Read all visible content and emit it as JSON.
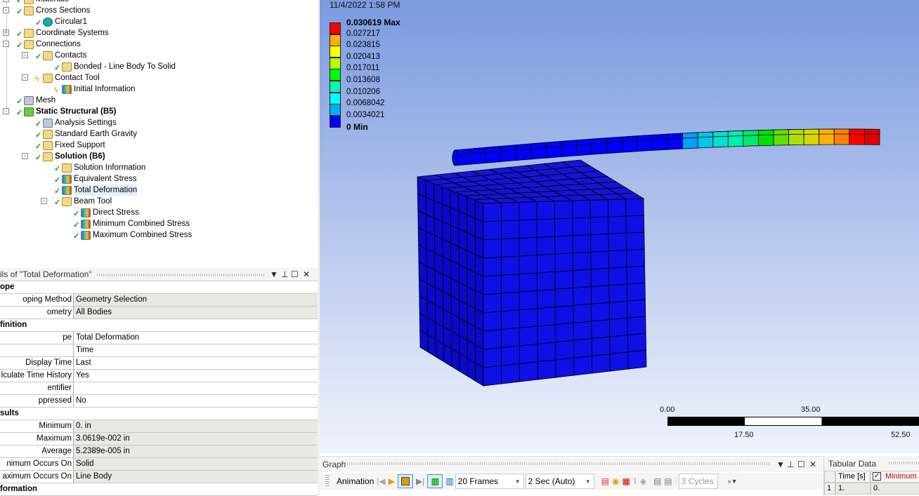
{
  "tree": [
    {
      "label": "Materials",
      "level": 0,
      "icon": "materials-icon",
      "status": "check",
      "exp": "+"
    },
    {
      "label": "Cross Sections",
      "level": 0,
      "icon": "cross-section-icon",
      "status": "check",
      "exp": "-"
    },
    {
      "label": "Circular1",
      "level": 1,
      "icon": "circular-section-icon",
      "status": "check"
    },
    {
      "label": "Coordinate Systems",
      "level": 0,
      "icon": "coordinate-systems-icon",
      "status": "check",
      "exp": "+"
    },
    {
      "label": "Connections",
      "level": 0,
      "icon": "connections-icon",
      "status": "check",
      "exp": "-"
    },
    {
      "label": "Contacts",
      "level": 1,
      "icon": "contacts-folder-icon",
      "status": "check",
      "exp": "-"
    },
    {
      "label": "Bonded - Line Body To Solid",
      "level": 2,
      "icon": "bonded-contact-icon",
      "status": "check"
    },
    {
      "label": "Contact Tool",
      "level": 1,
      "icon": "contact-tool-icon",
      "status": "bolt",
      "exp": "-"
    },
    {
      "label": "Initial Information",
      "level": 2,
      "icon": "result-icon",
      "status": "bolt"
    },
    {
      "label": "Mesh",
      "level": 0,
      "icon": "mesh-icon",
      "status": "check"
    },
    {
      "label": "Static Structural (B5)",
      "level": 0,
      "icon": "static-structural-icon",
      "status": "check",
      "exp": "-",
      "bold": true
    },
    {
      "label": "Analysis Settings",
      "level": 1,
      "icon": "analysis-settings-icon",
      "status": "check"
    },
    {
      "label": "Standard Earth Gravity",
      "level": 1,
      "icon": "gravity-icon",
      "status": "check"
    },
    {
      "label": "Fixed Support",
      "level": 1,
      "icon": "fixed-support-icon",
      "status": "check"
    },
    {
      "label": "Solution (B6)",
      "level": 1,
      "icon": "solution-icon",
      "status": "check",
      "exp": "-",
      "bold": true
    },
    {
      "label": "Solution Information",
      "level": 2,
      "icon": "solution-information-icon",
      "status": "check"
    },
    {
      "label": "Equivalent Stress",
      "level": 2,
      "icon": "result-icon",
      "status": "check"
    },
    {
      "label": "Total Deformation",
      "level": 2,
      "icon": "result-icon",
      "status": "check",
      "selected": true
    },
    {
      "label": "Beam Tool",
      "level": 2,
      "icon": "beam-tool-icon",
      "status": "check",
      "exp": "-"
    },
    {
      "label": "Direct Stress",
      "level": 3,
      "icon": "result-icon",
      "status": "check"
    },
    {
      "label": "Minimum Combined Stress",
      "level": 3,
      "icon": "result-icon",
      "status": "check"
    },
    {
      "label": "Maximum Combined Stress",
      "level": 3,
      "icon": "result-icon",
      "status": "check"
    }
  ],
  "details": {
    "title": "ils of \"Total Deformation\"",
    "rows": [
      {
        "k": "ope",
        "section": true
      },
      {
        "k": "oping Method",
        "v": "Geometry Selection",
        "grey": true
      },
      {
        "k": "ometry",
        "v": "All Bodies",
        "grey": true
      },
      {
        "k": "finition",
        "section": true
      },
      {
        "k": "pe",
        "v": "Total Deformation"
      },
      {
        "k": "",
        "v": "Time"
      },
      {
        "k": " Display Time",
        "v": "Last"
      },
      {
        "k": "lculate Time History",
        "v": "Yes"
      },
      {
        "k": "entifier",
        "v": ""
      },
      {
        "k": "ppressed",
        "v": "No"
      },
      {
        "k": "sults",
        "section": true
      },
      {
        "k": " Minimum",
        "v": "0. in",
        "grey": true
      },
      {
        "k": " Maximum",
        "v": "3.0619e-002 in",
        "grey": true
      },
      {
        "k": " Average",
        "v": "5.2389e-005 in",
        "grey": true
      },
      {
        "k": "nimum Occurs On",
        "v": "Solid",
        "grey": true
      },
      {
        "k": "aximum Occurs On",
        "v": "Line Body",
        "grey": true
      },
      {
        "k": "formation",
        "section": true
      }
    ]
  },
  "viewport": {
    "datestamp": "11/4/2022 1:58 PM",
    "legend": [
      {
        "label": "0.030619 Max",
        "color": "#ff0000",
        "bold": true
      },
      {
        "label": "0.027217",
        "color": "#ffb000"
      },
      {
        "label": "0.023815",
        "color": "#ffff00"
      },
      {
        "label": "0.020413",
        "color": "#b8ff00"
      },
      {
        "label": "0.017011",
        "color": "#00ff00"
      },
      {
        "label": "0.013608",
        "color": "#00ffb0"
      },
      {
        "label": "0.010206",
        "color": "#00ffff"
      },
      {
        "label": "0.0068042",
        "color": "#00b0ff"
      },
      {
        "label": "0.0034021",
        "color": "#0000ff"
      },
      {
        "label": "0 Min",
        "bold": true
      }
    ],
    "scale": {
      "top": [
        "0.00",
        "35.00"
      ],
      "bottom": [
        "17.50",
        "52.50"
      ]
    }
  },
  "graph": {
    "title": "Graph",
    "animation": "Animation",
    "frames": "20 Frames",
    "duration": "2 Sec (Auto)",
    "cycles": "3 Cycles"
  },
  "tabular": {
    "title": "Tabular Data",
    "col1": "Time [s]",
    "col2": "Minimum",
    "row_num": "1",
    "time": "1.",
    "min": "0."
  }
}
